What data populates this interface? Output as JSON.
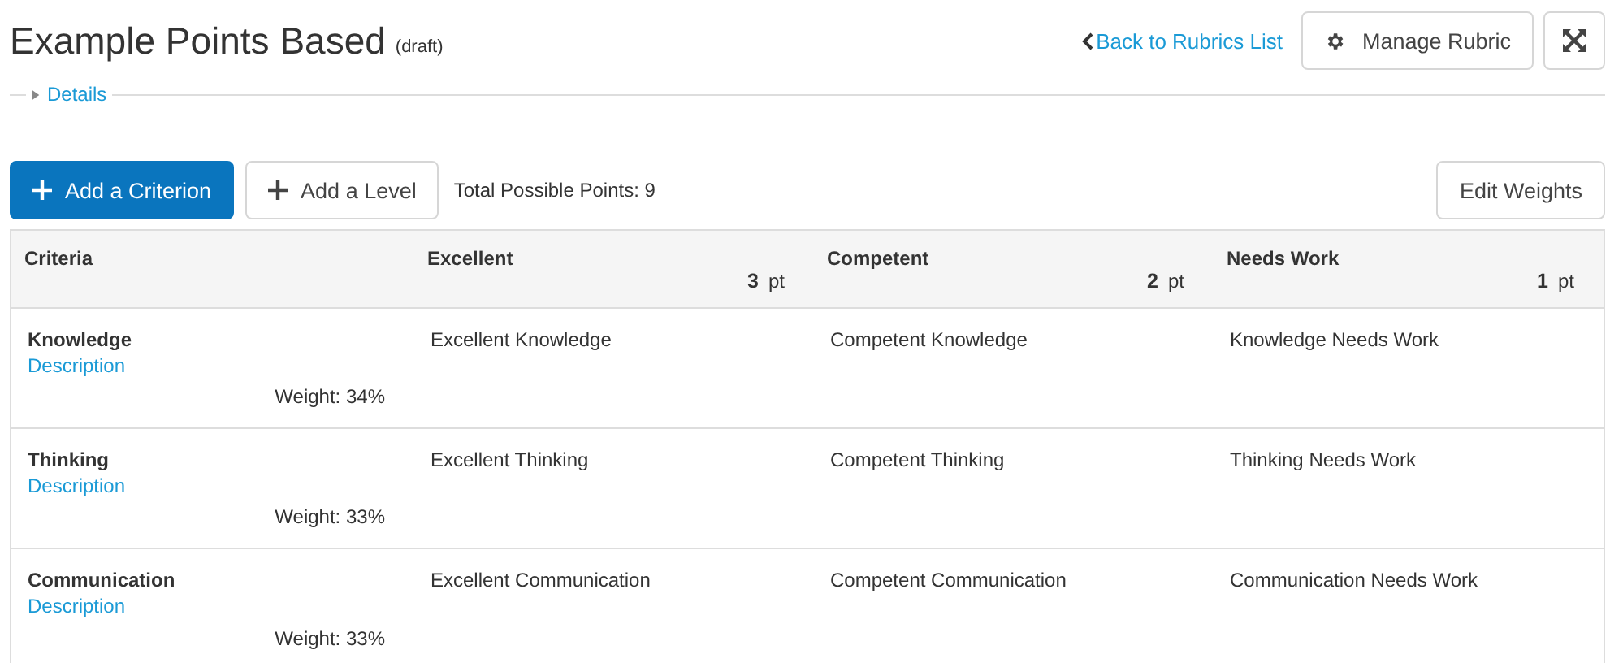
{
  "header": {
    "title": "Example Points Based",
    "status": "(draft)",
    "back_link": "Back to Rubrics List",
    "manage_button": "Manage Rubric"
  },
  "details": {
    "label": "Details",
    "expanded": false
  },
  "toolbar": {
    "add_criterion": "Add a Criterion",
    "add_level": "Add a Level",
    "total_points": "Total Possible Points: 9",
    "edit_weights": "Edit Weights"
  },
  "table": {
    "criteria_heading": "Criteria",
    "levels": [
      {
        "name": "Excellent",
        "points": "3",
        "unit": "pt"
      },
      {
        "name": "Competent",
        "points": "2",
        "unit": "pt"
      },
      {
        "name": "Needs Work",
        "points": "1",
        "unit": "pt"
      }
    ],
    "rows": [
      {
        "name": "Knowledge",
        "description_link": "Description",
        "weight": "Weight: 34%",
        "cells": [
          "Excellent Knowledge",
          "Competent Knowledge",
          "Knowledge Needs Work"
        ]
      },
      {
        "name": "Thinking",
        "description_link": "Description",
        "weight": "Weight: 33%",
        "cells": [
          "Excellent Thinking",
          "Competent Thinking",
          "Thinking Needs Work"
        ]
      },
      {
        "name": "Communication",
        "description_link": "Description",
        "weight": "Weight: 33%",
        "cells": [
          "Excellent Communication",
          "Competent Communication",
          "Communication Needs Work"
        ]
      }
    ]
  }
}
